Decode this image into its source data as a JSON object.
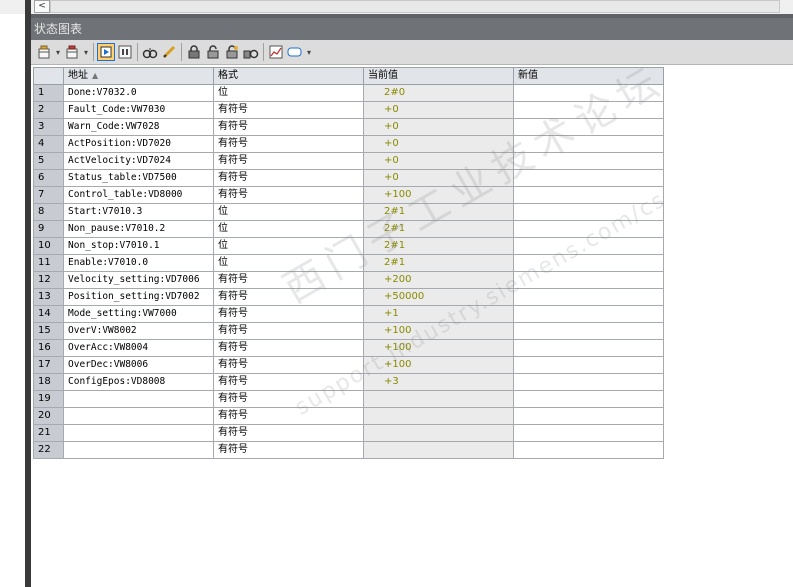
{
  "window": {
    "title": "状态图表"
  },
  "scrollbar": {
    "left_arrow": "<"
  },
  "table": {
    "headers": {
      "row_num": "",
      "address": "地址",
      "format": "格式",
      "current_value": "当前值",
      "new_value": "新值"
    },
    "rows": [
      {
        "n": "1",
        "addr": "Done:V7032.0",
        "fmt": "位",
        "cur": "2#0",
        "new": ""
      },
      {
        "n": "2",
        "addr": "Fault_Code:VW7030",
        "fmt": "有符号",
        "cur": "+0",
        "new": ""
      },
      {
        "n": "3",
        "addr": "Warn_Code:VW7028",
        "fmt": "有符号",
        "cur": "+0",
        "new": ""
      },
      {
        "n": "4",
        "addr": "ActPosition:VD7020",
        "fmt": "有符号",
        "cur": "+0",
        "new": ""
      },
      {
        "n": "5",
        "addr": "ActVelocity:VD7024",
        "fmt": "有符号",
        "cur": "+0",
        "new": ""
      },
      {
        "n": "6",
        "addr": "Status_table:VD7500",
        "fmt": "有符号",
        "cur": "+0",
        "new": ""
      },
      {
        "n": "7",
        "addr": "Control_table:VD8000",
        "fmt": "有符号",
        "cur": "+100",
        "new": ""
      },
      {
        "n": "8",
        "addr": "Start:V7010.3",
        "fmt": "位",
        "cur": "2#1",
        "new": ""
      },
      {
        "n": "9",
        "addr": "Non_pause:V7010.2",
        "fmt": "位",
        "cur": "2#1",
        "new": ""
      },
      {
        "n": "10",
        "addr": "Non_stop:V7010.1",
        "fmt": "位",
        "cur": "2#1",
        "new": ""
      },
      {
        "n": "11",
        "addr": "Enable:V7010.0",
        "fmt": "位",
        "cur": "2#1",
        "new": ""
      },
      {
        "n": "12",
        "addr": "Velocity_setting:VD7006",
        "fmt": "有符号",
        "cur": "+200",
        "new": ""
      },
      {
        "n": "13",
        "addr": "Position_setting:VD7002",
        "fmt": "有符号",
        "cur": "+50000",
        "new": ""
      },
      {
        "n": "14",
        "addr": "Mode_setting:VW7000",
        "fmt": "有符号",
        "cur": "+1",
        "new": ""
      },
      {
        "n": "15",
        "addr": "OverV:VW8002",
        "fmt": "有符号",
        "cur": "+100",
        "new": ""
      },
      {
        "n": "16",
        "addr": "OverAcc:VW8004",
        "fmt": "有符号",
        "cur": "+100",
        "new": ""
      },
      {
        "n": "17",
        "addr": "OverDec:VW8006",
        "fmt": "有符号",
        "cur": "+100",
        "new": ""
      },
      {
        "n": "18",
        "addr": "ConfigEpos:VD8008",
        "fmt": "有符号",
        "cur": "+3",
        "new": ""
      },
      {
        "n": "19",
        "addr": "",
        "fmt": "有符号",
        "cur": "",
        "new": ""
      },
      {
        "n": "20",
        "addr": "",
        "fmt": "有符号",
        "cur": "",
        "new": ""
      },
      {
        "n": "21",
        "addr": "",
        "fmt": "有符号",
        "cur": "",
        "new": ""
      },
      {
        "n": "22",
        "addr": "",
        "fmt": "有符号",
        "cur": "",
        "new": ""
      }
    ]
  },
  "watermark": {
    "line1": "西门子工业技术论坛",
    "line2": "support.industry.siemens.com/cs"
  },
  "colors": {
    "title_bar": "#6f7276",
    "current_value_text": "#8a8a00",
    "row_number_bg": "#c8ccd2"
  }
}
